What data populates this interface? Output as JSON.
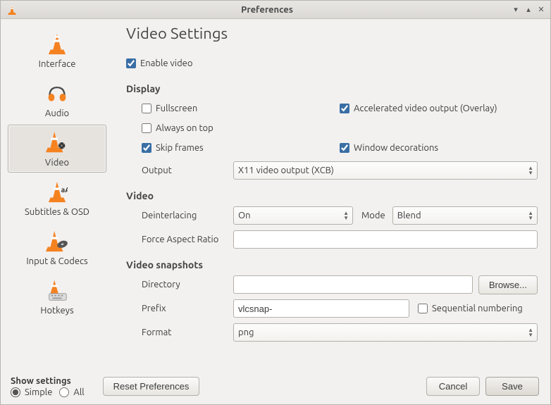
{
  "window": {
    "title": "Preferences"
  },
  "sidebar": {
    "items": [
      {
        "label": "Interface"
      },
      {
        "label": "Audio"
      },
      {
        "label": "Video"
      },
      {
        "label": "Subtitles & OSD"
      },
      {
        "label": "Input & Codecs"
      },
      {
        "label": "Hotkeys"
      }
    ]
  },
  "page": {
    "heading": "Video Settings",
    "enable_video": "Enable video",
    "display_title": "Display",
    "fullscreen": "Fullscreen",
    "accelerated": "Accelerated video output (Overlay)",
    "always_on_top": "Always on top",
    "skip_frames": "Skip frames",
    "window_decorations": "Window decorations",
    "output_label": "Output",
    "output_value": "X11 video output (XCB)",
    "video_title": "Video",
    "deinterlacing_label": "Deinterlacing",
    "deinterlacing_value": "On",
    "mode_label": "Mode",
    "mode_value": "Blend",
    "force_ar_label": "Force Aspect Ratio",
    "force_ar_value": "",
    "snapshots_title": "Video snapshots",
    "directory_label": "Directory",
    "directory_value": "",
    "browse": "Browse...",
    "prefix_label": "Prefix",
    "prefix_value": "vlcsnap-",
    "sequential": "Sequential numbering",
    "format_label": "Format",
    "format_value": "png"
  },
  "show_settings": {
    "title": "Show settings",
    "simple": "Simple",
    "all": "All"
  },
  "buttons": {
    "reset": "Reset Preferences",
    "cancel": "Cancel",
    "save": "Save"
  }
}
